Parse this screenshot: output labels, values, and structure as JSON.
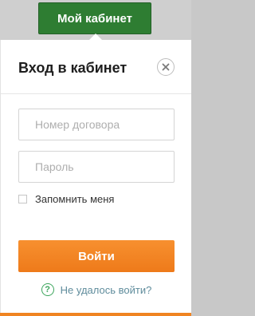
{
  "header": {
    "cabinet_button_label": "Мой кабинет"
  },
  "login_popup": {
    "title": "Вход в кабинет",
    "close_icon": "close-icon",
    "contract_field": {
      "placeholder": "Номер договора",
      "value": ""
    },
    "password_field": {
      "placeholder": "Пароль",
      "value": ""
    },
    "remember_label": "Запомнить меня",
    "remember_checked": false,
    "submit_label": "Войти",
    "help_icon": "question-icon",
    "help_link": "Не удалось войти?"
  },
  "colors": {
    "cabinet_button": "#2e7d32",
    "submit_button": "#f08421",
    "help_icon": "#3ca55c",
    "help_link": "#5f8c9c",
    "accent_bar": "#f08421"
  }
}
